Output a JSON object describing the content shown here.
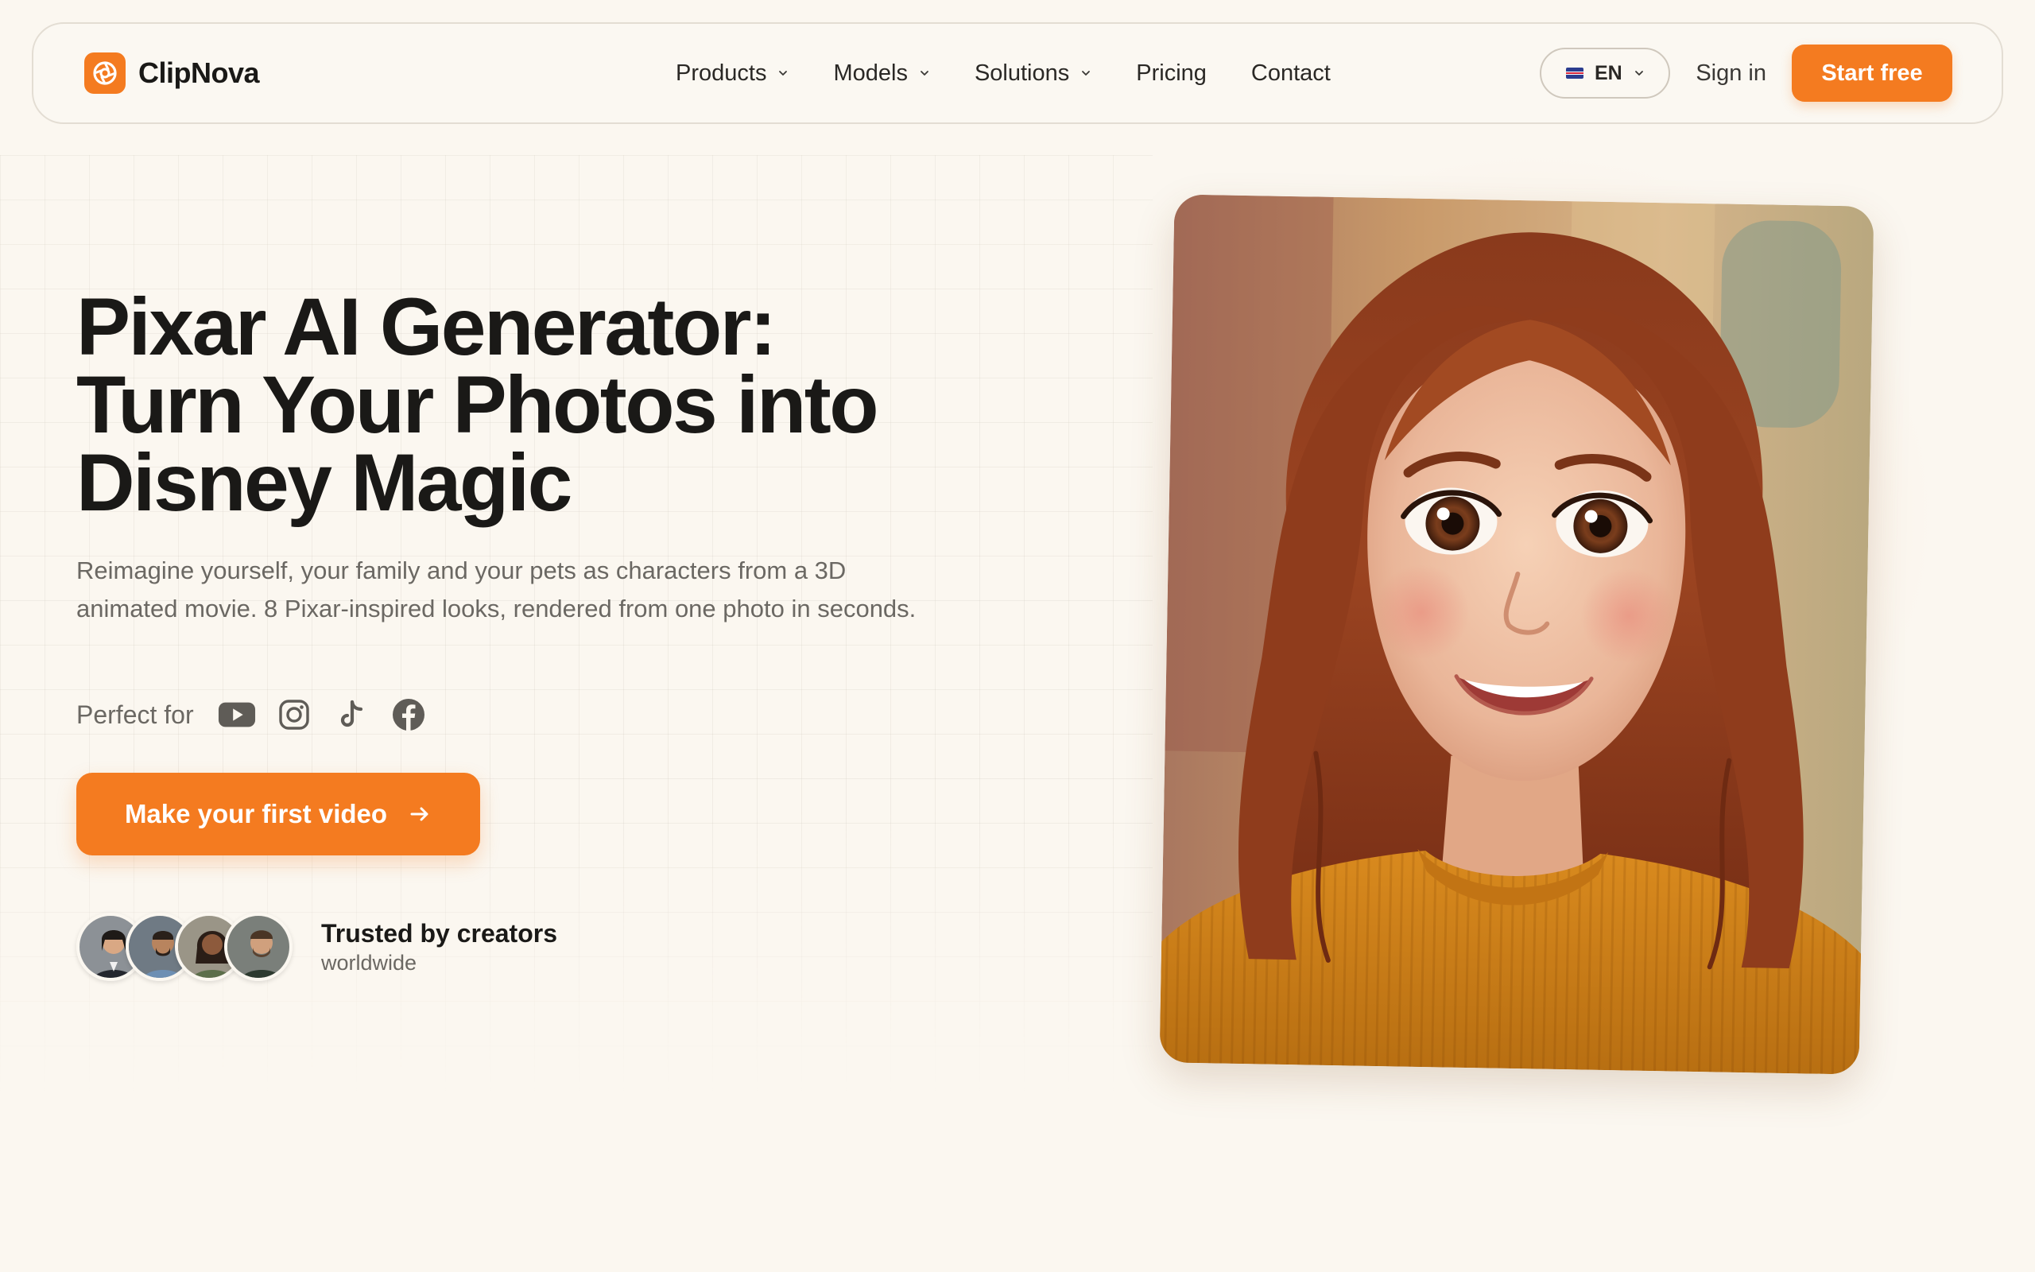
{
  "brand": {
    "name": "ClipNova",
    "accent_color": "#f47b20",
    "logo_icon": "aperture-icon"
  },
  "nav": {
    "items": [
      {
        "label": "Products",
        "has_dropdown": true
      },
      {
        "label": "Models",
        "has_dropdown": true
      },
      {
        "label": "Solutions",
        "has_dropdown": true
      },
      {
        "label": "Pricing",
        "has_dropdown": false
      },
      {
        "label": "Contact",
        "has_dropdown": false
      }
    ],
    "language": {
      "code": "EN",
      "flag_icon": "uk-flag-icon"
    },
    "sign_in_label": "Sign in",
    "start_label": "Start free"
  },
  "hero": {
    "title_lines": [
      "Pixar AI Generator:",
      "Turn Your Photos into",
      "Disney Magic"
    ],
    "description": "Reimagine yourself, your family and your pets as characters from a 3D animated movie. 8 Pixar-inspired looks, rendered from one photo in seconds.",
    "perfect_for_label": "Perfect for",
    "platforms": [
      "youtube-icon",
      "instagram-icon",
      "tiktok-icon",
      "facebook-icon"
    ],
    "cta_label": "Make your first video",
    "cta_icon": "arrow-right-icon",
    "trust_title": "Trusted by creators",
    "trust_subtitle": "worldwide",
    "avatar_count": 4,
    "image_alt": "pixar-style-portrait"
  }
}
